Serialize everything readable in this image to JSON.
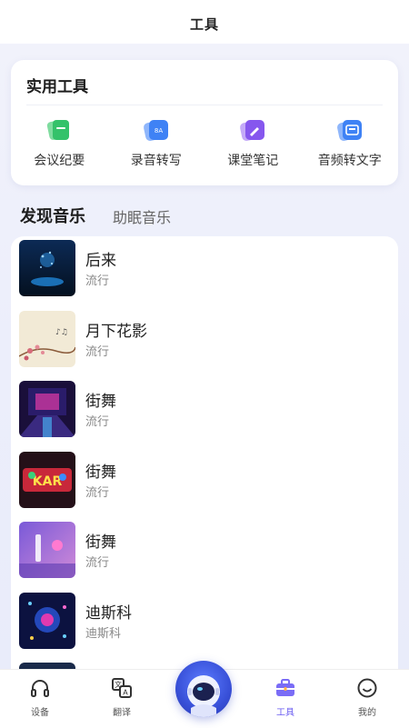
{
  "header": {
    "title": "工具"
  },
  "tools": {
    "title": "实用工具",
    "items": [
      {
        "label": "会议纪要",
        "icon": "meeting-notes-icon",
        "color": "#3ec46d"
      },
      {
        "label": "录音转写",
        "icon": "recording-transcribe-icon",
        "color": "#4d8af6"
      },
      {
        "label": "课堂笔记",
        "icon": "class-notes-icon",
        "color": "#8a63f0"
      },
      {
        "label": "音频转文字",
        "icon": "audio-to-text-icon",
        "color": "#4d8af6"
      }
    ]
  },
  "music_tabs": {
    "active": "发现音乐",
    "inactive": "助眠音乐"
  },
  "music_list": [
    {
      "title": "后来",
      "genre": "流行"
    },
    {
      "title": "月下花影",
      "genre": "流行"
    },
    {
      "title": "街舞",
      "genre": "流行"
    },
    {
      "title": "街舞",
      "genre": "流行"
    },
    {
      "title": "街舞",
      "genre": "流行"
    },
    {
      "title": "迪斯科",
      "genre": "迪斯科"
    }
  ],
  "tabbar": {
    "items": [
      {
        "label": "设备",
        "icon": "headphones-icon"
      },
      {
        "label": "翻译",
        "icon": "translate-icon"
      },
      {
        "label": "工具",
        "icon": "toolbox-icon",
        "active": true
      },
      {
        "label": "我的",
        "icon": "smiley-icon"
      }
    ],
    "center": "astronaut-icon"
  },
  "colors": {
    "accent": "#6a5cf0",
    "background": "#eceefb"
  }
}
